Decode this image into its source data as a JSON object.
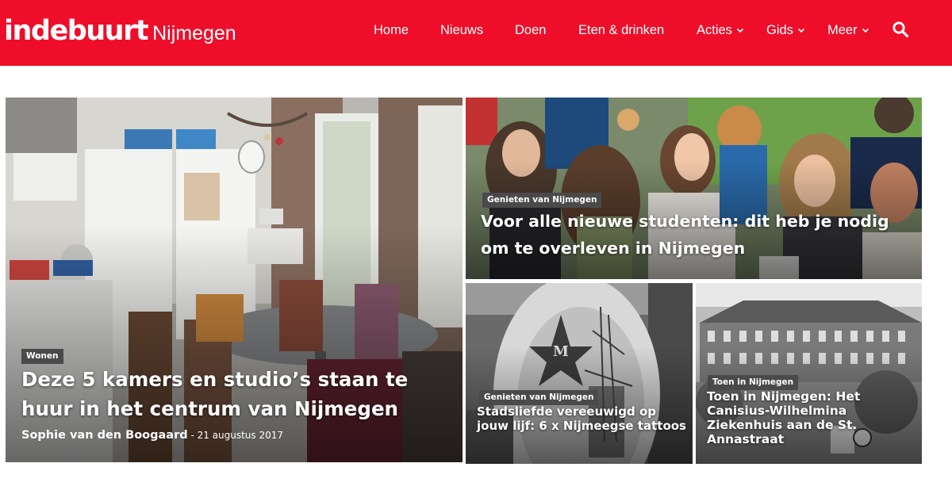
{
  "header": {
    "logo_main": "indebuurt",
    "logo_city": "Nijmegen",
    "brand_color": "#ee0e2a",
    "nav": [
      {
        "label": "Home",
        "dropdown": false
      },
      {
        "label": "Nieuws",
        "dropdown": false
      },
      {
        "label": "Doen",
        "dropdown": false
      },
      {
        "label": "Eten & drinken",
        "dropdown": false
      },
      {
        "label": "Acties",
        "dropdown": true
      },
      {
        "label": "Gids",
        "dropdown": true
      },
      {
        "label": "Meer",
        "dropdown": true
      }
    ],
    "search_icon": "search-icon"
  },
  "articles": {
    "main": {
      "category": "Wonen",
      "title": "Deze 5 kamers en studio’s staan te huur in het centrum van Nijmegen",
      "author": "Sophie van den Boogaard",
      "date": "- 21 augustus 2017"
    },
    "top_right": {
      "category": "Genieten van Nijmegen",
      "title": "Voor alle nieuwe studenten: dit heb je nodig om te overleven in Nijmegen"
    },
    "bottom_mid": {
      "category": "Genieten van Nijmegen",
      "title": "Stadsliefde vereeuwigd op jouw lijf: 6 x Nijmeegse tattoos"
    },
    "bottom_right": {
      "category": "Toen in Nijmegen",
      "title": "Toen in Nijmegen: Het Canisius-Wilhelmina Ziekenhuis aan de St. Annastraat"
    }
  }
}
